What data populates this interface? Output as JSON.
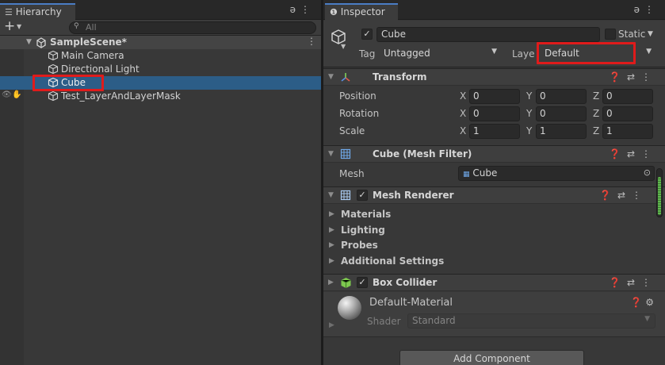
{
  "hierarchy": {
    "tab_label": "Hierarchy",
    "add_label": "+",
    "search_placeholder": "All",
    "scene_name": "SampleScene*",
    "items": [
      {
        "label": "Main Camera"
      },
      {
        "label": "Directional Light"
      },
      {
        "label": "Cube"
      },
      {
        "label": "Test_LayerAndLayerMask"
      }
    ],
    "selected_index": 2
  },
  "inspector": {
    "tab_label": "Inspector",
    "object_name": "Cube",
    "static_label": "Static",
    "tag_label": "Tag",
    "tag_value": "Untagged",
    "layer_label": "Laye",
    "layer_value": "Default",
    "transform": {
      "title": "Transform",
      "rows": [
        {
          "label": "Position",
          "x": "0",
          "y": "0",
          "z": "0"
        },
        {
          "label": "Rotation",
          "x": "0",
          "y": "0",
          "z": "0"
        },
        {
          "label": "Scale",
          "x": "1",
          "y": "1",
          "z": "1"
        }
      ]
    },
    "axis_labels": {
      "x": "X",
      "y": "Y",
      "z": "Z"
    },
    "mesh_filter": {
      "title": "Cube (Mesh Filter)",
      "mesh_label": "Mesh",
      "mesh_value": "Cube"
    },
    "mesh_renderer": {
      "title": "Mesh Renderer",
      "sections": [
        "Materials",
        "Lighting",
        "Probes",
        "Additional Settings"
      ]
    },
    "box_collider": {
      "title": "Box Collider"
    },
    "material": {
      "name": "Default-Material",
      "shader_label": "Shader",
      "shader_value": "Standard"
    },
    "add_component_label": "Add Component"
  },
  "colors": {
    "selection": "#2c5d87",
    "highlight_box": "#e01b1b",
    "accent_tab": "#4a7dc4",
    "scrollbar_green": "#5fb84e"
  }
}
